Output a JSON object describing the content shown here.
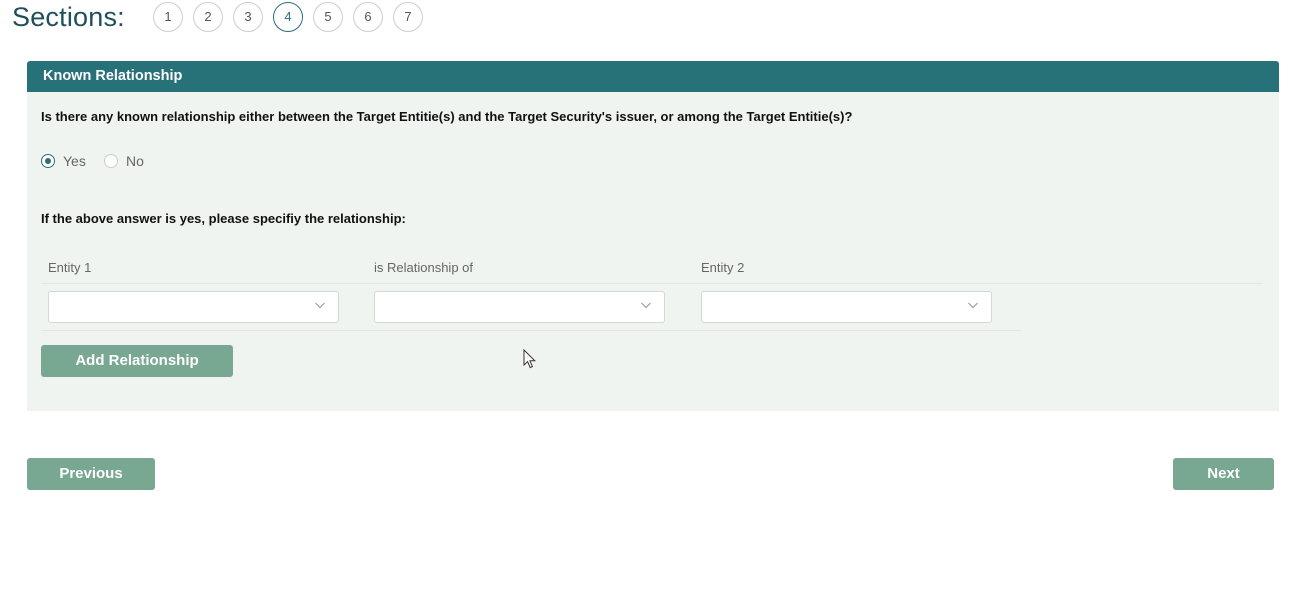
{
  "header": {
    "title": "Sections:",
    "steps": [
      "1",
      "2",
      "3",
      "4",
      "5",
      "6",
      "7"
    ],
    "active_step": "4"
  },
  "panel": {
    "title": "Known Relationship",
    "question": "Is there any known relationship either between the Target Entitie(s) and the Target Security's issuer, or among the Target Entitie(s)?",
    "radio": {
      "options": [
        "Yes",
        "No"
      ],
      "selected": "Yes"
    },
    "sub_question": "If the above answer is yes, please specifiy the relationship:",
    "columns": {
      "entity1": "Entity 1",
      "relationship": "is Relationship of",
      "entity2": "Entity 2"
    },
    "selects": {
      "entity1_value": "",
      "relationship_value": "",
      "entity2_value": ""
    },
    "add_button": "Add Relationship"
  },
  "footer": {
    "previous": "Previous",
    "next": "Next"
  },
  "colors": {
    "accent": "#277179",
    "button": "#78a891",
    "panel_bg": "#f0f4f1",
    "title": "#1f4f5a"
  },
  "icons": {
    "select_arrow": "chevron-down-icon",
    "pointer": "mouse-cursor-icon"
  }
}
